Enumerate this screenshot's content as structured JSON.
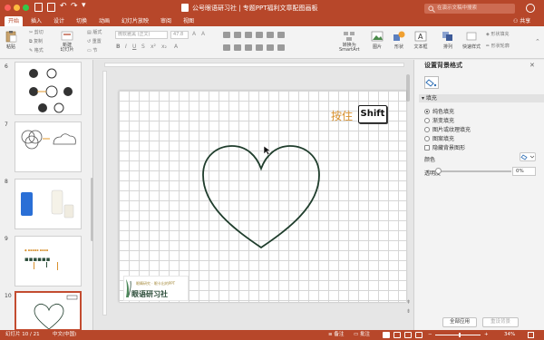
{
  "window": {
    "title": "公号眼语研习社 | 专题PPT福利文章配图画板"
  },
  "search": {
    "placeholder": "在演示文稿中搜索"
  },
  "tabs": [
    {
      "label": "开始"
    },
    {
      "label": "插入"
    },
    {
      "label": "设计"
    },
    {
      "label": "切换"
    },
    {
      "label": "动画"
    },
    {
      "label": "幻灯片放映"
    },
    {
      "label": "审阅"
    },
    {
      "label": "视图"
    }
  ],
  "share_label": "共享",
  "ribbon": {
    "paste": "粘贴",
    "cut": "剪切",
    "copy": "复制",
    "format": "格式",
    "new_slide": "新建\n幻灯片",
    "layout": "版式",
    "reset": "重置",
    "section": "节",
    "font_name": "微软雅黑 (正文)",
    "font_size": "47.8",
    "convert_smartart": "转换为\nSmartArt",
    "picture": "图片",
    "shape": "形状",
    "textbox": "文本框",
    "arrange": "排列",
    "quick_styles": "快速样式",
    "shape_fill": "形状填充",
    "shape_outline": "形状轮廓"
  },
  "thumbnails": [
    {
      "number": "6"
    },
    {
      "number": "7"
    },
    {
      "number": "8"
    },
    {
      "number": "9"
    },
    {
      "number": "10"
    }
  ],
  "slide": {
    "press_text": "按住",
    "key_label": "Shift",
    "logo_name": "眼语研习社",
    "logo_tagline": "眼睛研究 · 眼卡出的PPT"
  },
  "pane": {
    "title": "设置背景格式",
    "section": "填充",
    "fill_options": [
      {
        "label": "纯色填充",
        "selected": true
      },
      {
        "label": "渐变填充",
        "selected": false
      },
      {
        "label": "图片或纹理填充",
        "selected": false
      },
      {
        "label": "图案填充",
        "selected": false
      },
      {
        "label": "隐藏背景图形",
        "selected": false
      }
    ],
    "color_label": "颜色",
    "transparency_label": "透明度",
    "transparency_value": "0%",
    "transparency_level": 0,
    "apply_all": "全部应用",
    "reset_bg": "重设背景"
  },
  "status": {
    "slide_info": "幻灯片 10 / 21",
    "language": "中文(中国)",
    "notes": "备注",
    "comments": "批注",
    "zoom": "34%"
  },
  "colors": {
    "accent": "#b7472a",
    "heart_stroke": "#1f3d2c",
    "key_text": "#d8912f"
  }
}
